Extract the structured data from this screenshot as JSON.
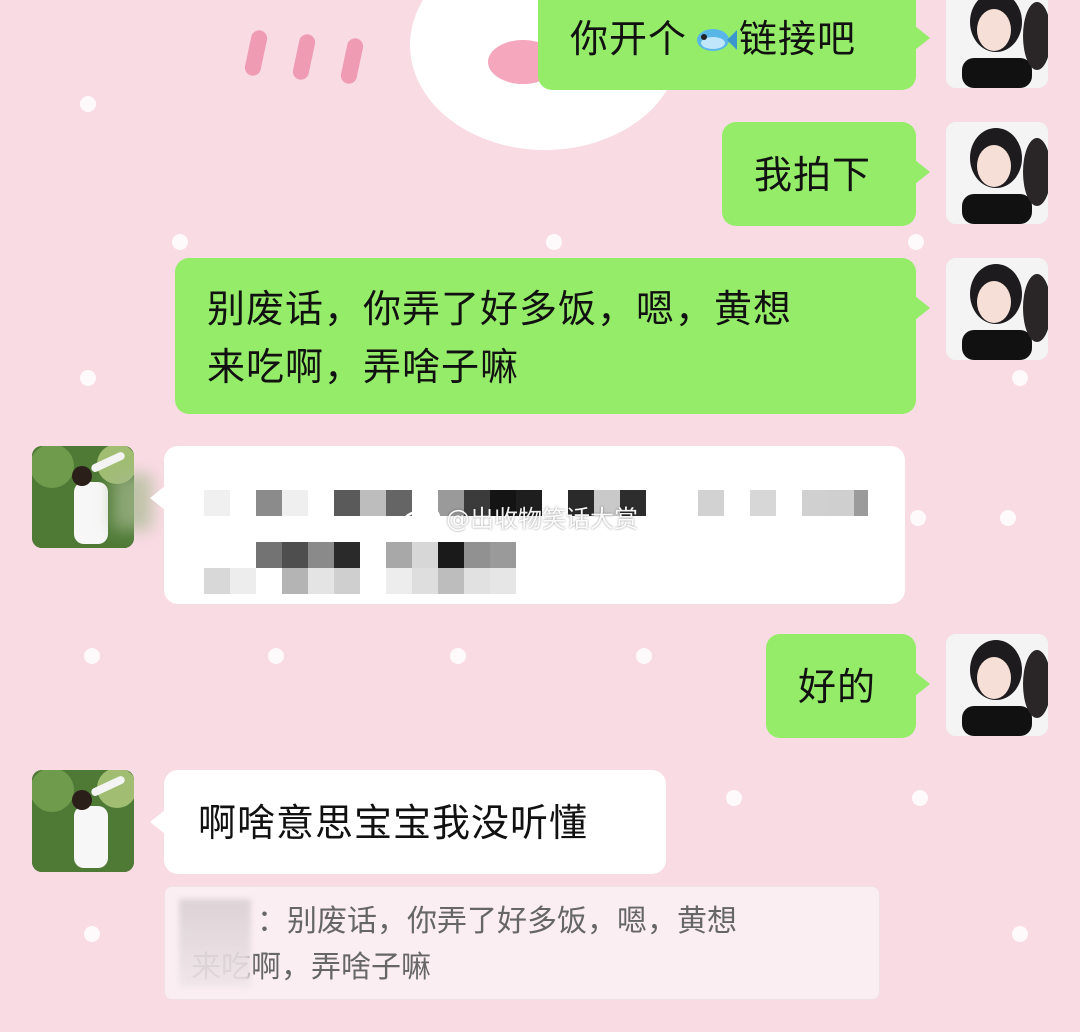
{
  "chat": {
    "messages": [
      {
        "from": "me",
        "text": "你开个"
      },
      {
        "from": "me",
        "text": "链接吧"
      },
      {
        "from": "me",
        "text": "我拍下"
      },
      {
        "from": "me",
        "text": "别废话，你弄了好多饭，嗯，黄想"
      },
      {
        "from": "me",
        "text": "来吃啊，弄啥子嘛"
      },
      {
        "from": "other",
        "text": "[censored image-like text]"
      },
      {
        "from": "me",
        "text": "好的"
      },
      {
        "from": "other",
        "text": "啊啥意思宝宝我没听懂"
      }
    ],
    "quote": {
      "line1": "：别废话，你弄了好多饭，嗯，黄想",
      "line2": "来吃啊，弄啥子嘛"
    },
    "watermark": "@出收物笑话大赏",
    "icons": {
      "emoji": "fish-emoji-icon",
      "weibo": "weibo-logo-icon"
    },
    "colors": {
      "me_bubble": "#95ec69",
      "other_bubble": "#ffffff",
      "background": "#f9dbe4"
    }
  }
}
